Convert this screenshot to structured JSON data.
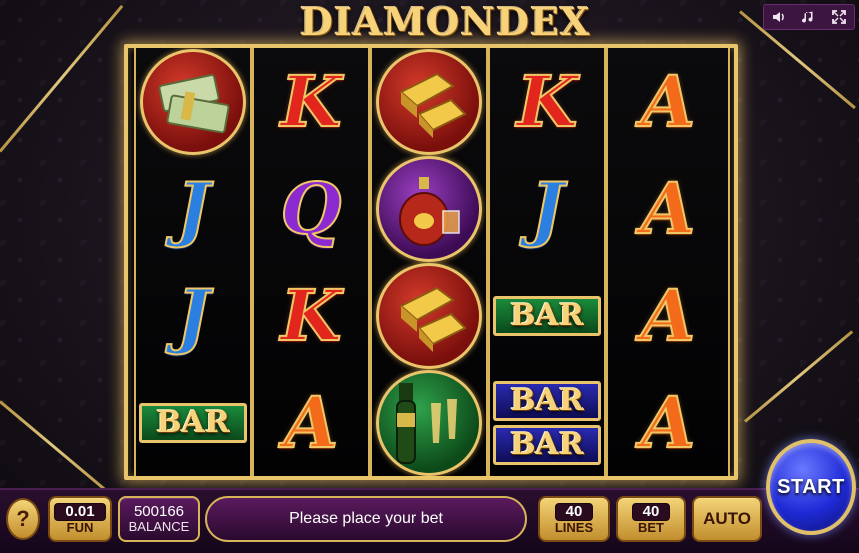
{
  "game": {
    "title": "DIAMONDEX"
  },
  "top_controls": {
    "sound_icon": "speaker-icon",
    "music_icon": "music-note-icon",
    "fullscreen_icon": "fullscreen-icon"
  },
  "reels": [
    [
      "money-stack",
      "J",
      "J",
      "BAR"
    ],
    [
      "K",
      "Q",
      "K",
      "A"
    ],
    [
      "gold-bars",
      "cognac",
      "gold-bars",
      "champagne"
    ],
    [
      "K",
      "J",
      "BAR",
      "BAR-BAR"
    ],
    [
      "A",
      "A",
      "A",
      "A"
    ]
  ],
  "bar_label": "BAR",
  "bottom_bar": {
    "help_label": "?",
    "coin_value": "0.01",
    "coin_label": "FUN",
    "balance_value": "500166",
    "balance_label": "BALANCE",
    "message": "Please place your bet",
    "lines_value": "40",
    "lines_label": "LINES",
    "bet_value": "40",
    "bet_label": "BET",
    "auto_label": "AUTO",
    "start_label": "START"
  },
  "colors": {
    "frame_gold": "#e8c56a",
    "panel_purple": "#5a1a5e",
    "start_blue": "#1f2ad6"
  }
}
